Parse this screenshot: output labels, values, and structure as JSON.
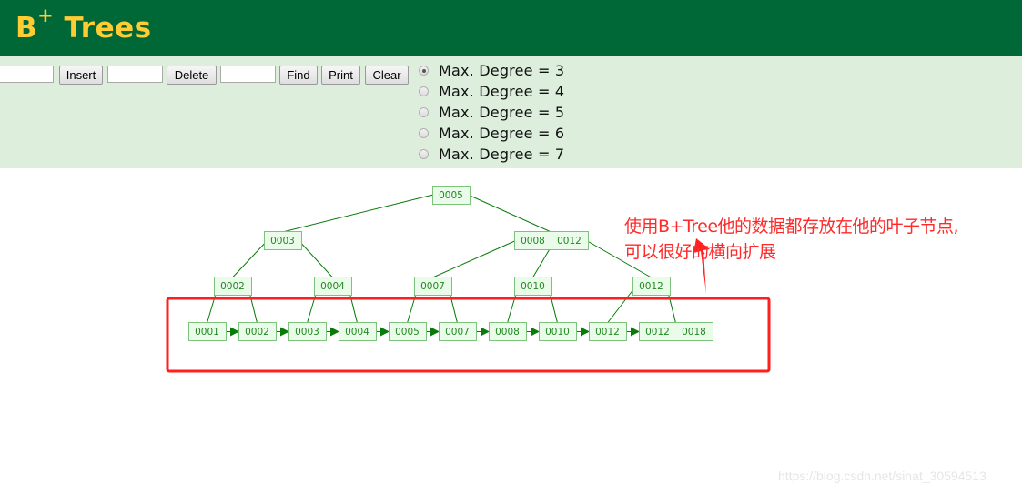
{
  "header": {
    "title_main": "B",
    "title_sup": "+",
    "title_rest": " Trees",
    "background": "#006837",
    "title_color": "#FFCC33"
  },
  "controls": {
    "insert_input_value": "",
    "insert_label": "Insert",
    "delete_input_value": "",
    "delete_label": "Delete",
    "find_input_value": "",
    "find_label": "Find",
    "print_label": "Print",
    "clear_label": "Clear",
    "degree_options": [
      {
        "label": "Max. Degree = 3",
        "checked": true
      },
      {
        "label": "Max. Degree = 4",
        "checked": false
      },
      {
        "label": "Max. Degree = 5",
        "checked": false
      },
      {
        "label": "Max. Degree = 6",
        "checked": false
      },
      {
        "label": "Max. Degree = 7",
        "checked": false
      }
    ]
  },
  "tree": {
    "colors": {
      "node_fill": "#EAFBEA",
      "node_border": "#7CC37C",
      "text": "#1E8A1E",
      "edge": "#0A7A0A"
    },
    "levels": [
      [
        {
          "id": "root",
          "keys": [
            "0005"
          ]
        }
      ],
      [
        {
          "id": "i1",
          "keys": [
            "0003"
          ]
        },
        {
          "id": "i2",
          "keys": [
            "0008",
            "0012"
          ]
        }
      ],
      [
        {
          "id": "p1",
          "keys": [
            "0002"
          ]
        },
        {
          "id": "p2",
          "keys": [
            "0004"
          ]
        },
        {
          "id": "p3",
          "keys": [
            "0007"
          ]
        },
        {
          "id": "p4",
          "keys": [
            "0010"
          ]
        },
        {
          "id": "p5",
          "keys": [
            "0012"
          ]
        }
      ],
      [
        {
          "id": "l1",
          "keys": [
            "0001"
          ]
        },
        {
          "id": "l2",
          "keys": [
            "0002"
          ]
        },
        {
          "id": "l3",
          "keys": [
            "0003"
          ]
        },
        {
          "id": "l4",
          "keys": [
            "0004"
          ]
        },
        {
          "id": "l5",
          "keys": [
            "0005"
          ]
        },
        {
          "id": "l6",
          "keys": [
            "0007"
          ]
        },
        {
          "id": "l7",
          "keys": [
            "0008"
          ]
        },
        {
          "id": "l8",
          "keys": [
            "0010"
          ]
        },
        {
          "id": "l9",
          "keys": [
            "0012"
          ]
        },
        {
          "id": "l10",
          "keys": [
            "0012",
            "0018"
          ]
        }
      ]
    ],
    "edges": [
      [
        "root",
        0,
        "i1"
      ],
      [
        "root",
        1,
        "i2"
      ],
      [
        "i1",
        0,
        "p1"
      ],
      [
        "i1",
        1,
        "p2"
      ],
      [
        "i2",
        0,
        "p3"
      ],
      [
        "i2",
        1,
        "p4"
      ],
      [
        "i2",
        2,
        "p5"
      ],
      [
        "p1",
        0,
        "l1"
      ],
      [
        "p1",
        1,
        "l2"
      ],
      [
        "p2",
        0,
        "l3"
      ],
      [
        "p2",
        1,
        "l4"
      ],
      [
        "p3",
        0,
        "l5"
      ],
      [
        "p3",
        1,
        "l6"
      ],
      [
        "p4",
        0,
        "l7"
      ],
      [
        "p4",
        1,
        "l8"
      ],
      [
        "p5",
        0,
        "l9"
      ],
      [
        "p5",
        1,
        "l10"
      ]
    ],
    "leaf_links": [
      [
        "l1",
        "l2"
      ],
      [
        "l2",
        "l3"
      ],
      [
        "l3",
        "l4"
      ],
      [
        "l4",
        "l5"
      ],
      [
        "l5",
        "l6"
      ],
      [
        "l6",
        "l7"
      ],
      [
        "l7",
        "l8"
      ],
      [
        "l8",
        "l9"
      ],
      [
        "l9",
        "l10"
      ]
    ]
  },
  "annotation": {
    "line1": "使用B+Tree他的数据都存放在他的叶子节点,",
    "line2": "可以很好的横向扩展",
    "color": "#FF2A2A"
  },
  "watermark": "https://blog.csdn.net/sinat_30594513"
}
